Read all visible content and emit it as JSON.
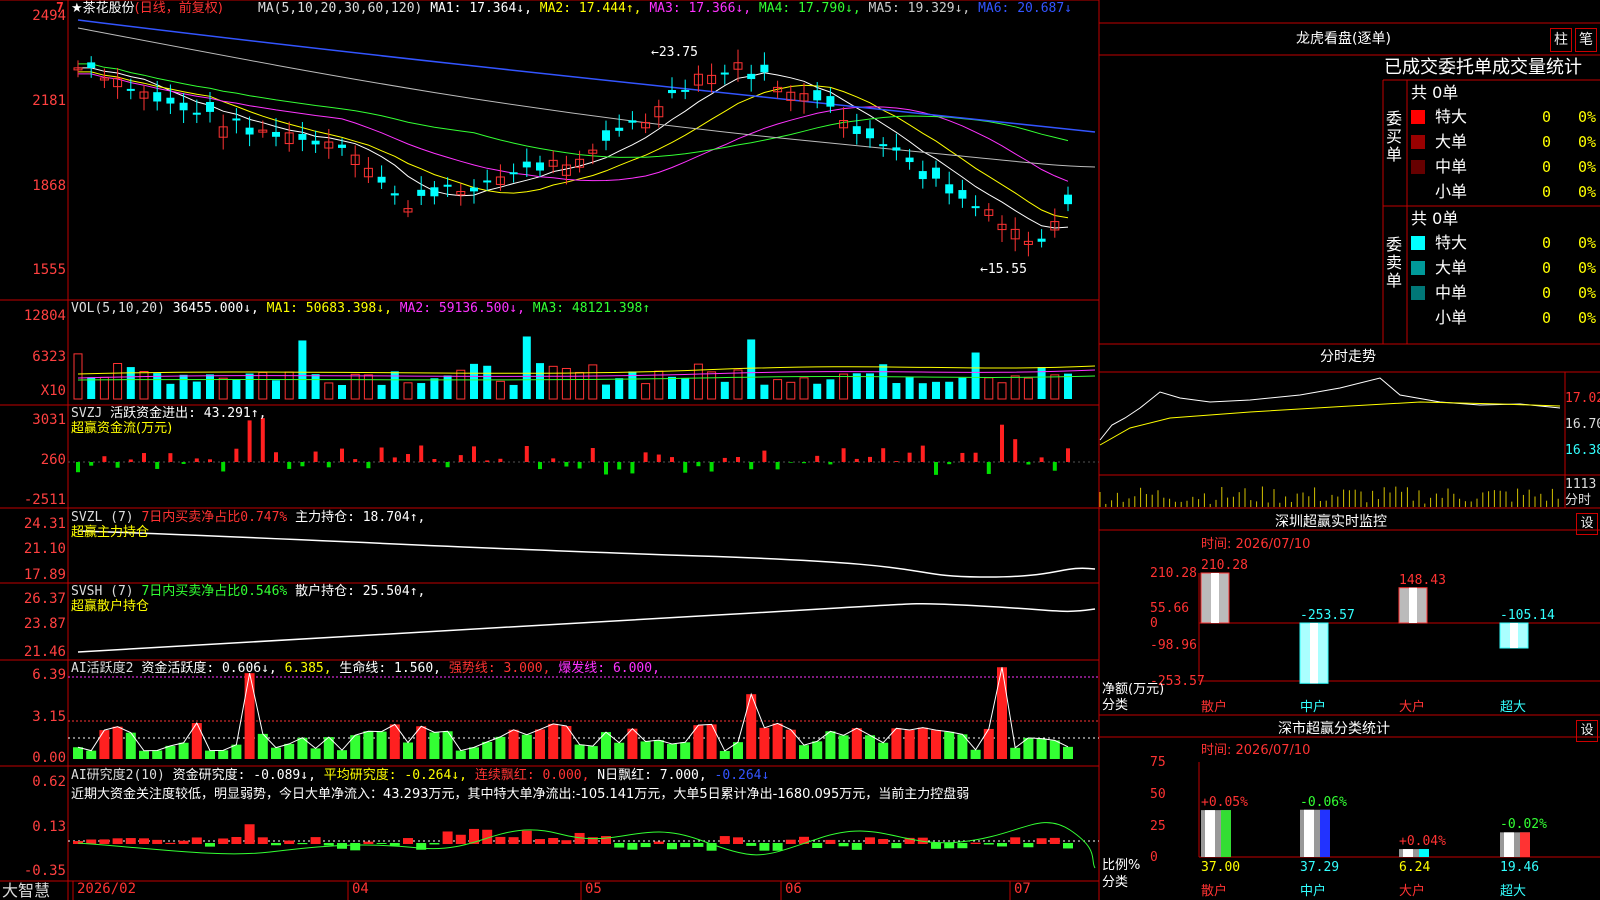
{
  "stock_title": {
    "name": "茶花股份",
    "mode": "(日线，前复权)"
  },
  "ma_line": [
    {
      "label": "MA(5,10,20,30,60,120)",
      "color": "#dddddd"
    },
    {
      "label": "MA1: 17.364↓,",
      "color": "#ffffff"
    },
    {
      "label": "MA2: 17.444↑,",
      "color": "#ffff00"
    },
    {
      "label": "MA3: 17.366↓,",
      "color": "#ff33ff"
    },
    {
      "label": "MA4: 17.790↓,",
      "color": "#33ff33"
    },
    {
      "label": "MA5: 19.329↓,",
      "color": "#cccccc"
    },
    {
      "label": "MA6: 20.687↓",
      "color": "#3355ff"
    }
  ],
  "price_axis": [
    "2494",
    "2181",
    "1868",
    "1555"
  ],
  "price_marks": {
    "high": "←23.75",
    "low": "←15.55"
  },
  "vol_axis": [
    "12804",
    "6323",
    "X10"
  ],
  "vol_line": [
    {
      "label": "VOL(5,10,20)",
      "color": "#dddddd"
    },
    {
      "label": "36455.000↓,",
      "color": "#ffffff"
    },
    {
      "label": "MA1: 50683.398↓,",
      "color": "#ffff00"
    },
    {
      "label": "MA2: 59136.500↓,",
      "color": "#ff33ff"
    },
    {
      "label": "MA3: 48121.398↑",
      "color": "#33ff33"
    }
  ],
  "svzj": {
    "axis": [
      "3031",
      "260",
      "-2511"
    ],
    "line1": [
      {
        "label": "SVZJ",
        "color": "#dddddd"
      },
      {
        "label": "活跃资金进出: 43.291↑,",
        "color": "#ffffff"
      }
    ],
    "line2": "超赢资金流(万元)"
  },
  "svzl": {
    "axis": [
      "24.31",
      "21.10",
      "17.89"
    ],
    "line1": [
      {
        "label": "SVZL (7)",
        "color": "#dddddd"
      },
      {
        "label": "7日内买卖净占比0.747%",
        "color": "#ff3333"
      },
      {
        "label": "主力持仓: 18.704↑,",
        "color": "#ffffff"
      }
    ],
    "line2": "超赢主力持仓"
  },
  "svsh": {
    "axis": [
      "26.37",
      "23.87",
      "21.46"
    ],
    "line1": [
      {
        "label": "SVSH (7)",
        "color": "#dddddd"
      },
      {
        "label": "7日内买卖净占比0.546%",
        "color": "#33ff33"
      },
      {
        "label": "散户持仓: 25.504↑,",
        "color": "#ffffff"
      }
    ],
    "line2": "超赢散户持仓"
  },
  "ai_active": {
    "axis": [
      "6.39",
      "3.15",
      "0.00"
    ],
    "line1": [
      {
        "label": "AI活跃度2",
        "color": "#dddddd"
      },
      {
        "label": "资金活跃度: 0.606↓,",
        "color": "#ffffff"
      },
      {
        "label": "6.385,",
        "color": "#ffff00"
      },
      {
        "label": "生命线: 1.560,",
        "color": "#ffffff"
      },
      {
        "label": "强势线: 3.000,",
        "color": "#ff3333"
      },
      {
        "label": "爆发线: 6.000,",
        "color": "#ff33ff"
      }
    ]
  },
  "ai_research": {
    "axis": [
      "0.62",
      "0.13",
      "-0.35"
    ],
    "line1": [
      {
        "label": "AI研究度2(10)",
        "color": "#dddddd"
      },
      {
        "label": "资金研究度: -0.089↓,",
        "color": "#ffffff"
      },
      {
        "label": "平均研究度: -0.264↓,",
        "color": "#ffff00"
      },
      {
        "label": "连续飘红: 0.000,",
        "color": "#ff3333"
      },
      {
        "label": "N日飘红: 7.000,",
        "color": "#ffffff"
      },
      {
        "label": "-0.264↓",
        "color": "#3355ff"
      }
    ],
    "summary": "近期大资金关注度较低，明显弱势，今日大单净流入：43.293万元，其中特大单净流出:-105.141万元，大单5日累计净出-1680.095万元，当前主力控盘弱"
  },
  "date_axis": [
    "2026/02",
    "04",
    "05",
    "06",
    "07"
  ],
  "bottom_brand": "大智慧",
  "right_panel": {
    "title": "龙虎看盘(逐单)",
    "tabs": [
      "柱",
      "笔"
    ],
    "section_header": "已成交委托单成交量统计",
    "buy": {
      "side_label": "委买单",
      "total": "共 0单",
      "rows": [
        {
          "name": "特大",
          "value": "0",
          "pct": "0%",
          "color": "#ff0000"
        },
        {
          "name": "大单",
          "value": "0",
          "pct": "0%",
          "color": "#990000"
        },
        {
          "name": "中单",
          "value": "0",
          "pct": "0%",
          "color": "#660000"
        },
        {
          "name": "小单",
          "value": "0",
          "pct": "0%",
          "color": ""
        }
      ]
    },
    "sell": {
      "side_label": "委卖单",
      "total": "共 0单",
      "rows": [
        {
          "name": "特大",
          "value": "0",
          "pct": "0%",
          "color": "#00ffff"
        },
        {
          "name": "大单",
          "value": "0",
          "pct": "0%",
          "color": "#009999"
        },
        {
          "name": "中单",
          "value": "0",
          "pct": "0%",
          "color": "#007777"
        },
        {
          "name": "小单",
          "value": "0",
          "pct": "0%",
          "color": ""
        }
      ]
    },
    "intraday": {
      "title": "分时走势",
      "axis": [
        "17.02",
        "16.70",
        "16.38"
      ],
      "vol_label": "1113",
      "time_label": "分时"
    },
    "monitor": {
      "title": "深圳超赢实时监控",
      "setting": "设",
      "time": "时间: 2026/07/10",
      "axis": [
        "210.28",
        "55.66",
        "0",
        "-98.96",
        "-253.57"
      ],
      "unit_label": "净额(万元)",
      "class_label": "分类",
      "chart_data": {
        "type": "bar",
        "categories": [
          "散户",
          "中户",
          "大户",
          "超大"
        ],
        "values": [
          210.28,
          -253.57,
          148.43,
          -105.14
        ],
        "ylim": [
          -253.57,
          210.28
        ]
      }
    },
    "classify": {
      "title": "深市超赢分类统计",
      "setting": "设",
      "time": "时间: 2026/07/10",
      "axis": [
        "75",
        "50",
        "25",
        "0"
      ],
      "ratio_label": "比例%",
      "class_label": "分类",
      "chart_data": {
        "type": "bar",
        "categories": [
          "散户",
          "中户",
          "大户",
          "超大"
        ],
        "values": [
          37.0,
          37.29,
          6.24,
          19.46
        ],
        "changes": [
          "+0.05%",
          "-0.06%",
          "+0.04%",
          "-0.02%"
        ],
        "ylim": [
          0,
          75
        ]
      }
    }
  }
}
